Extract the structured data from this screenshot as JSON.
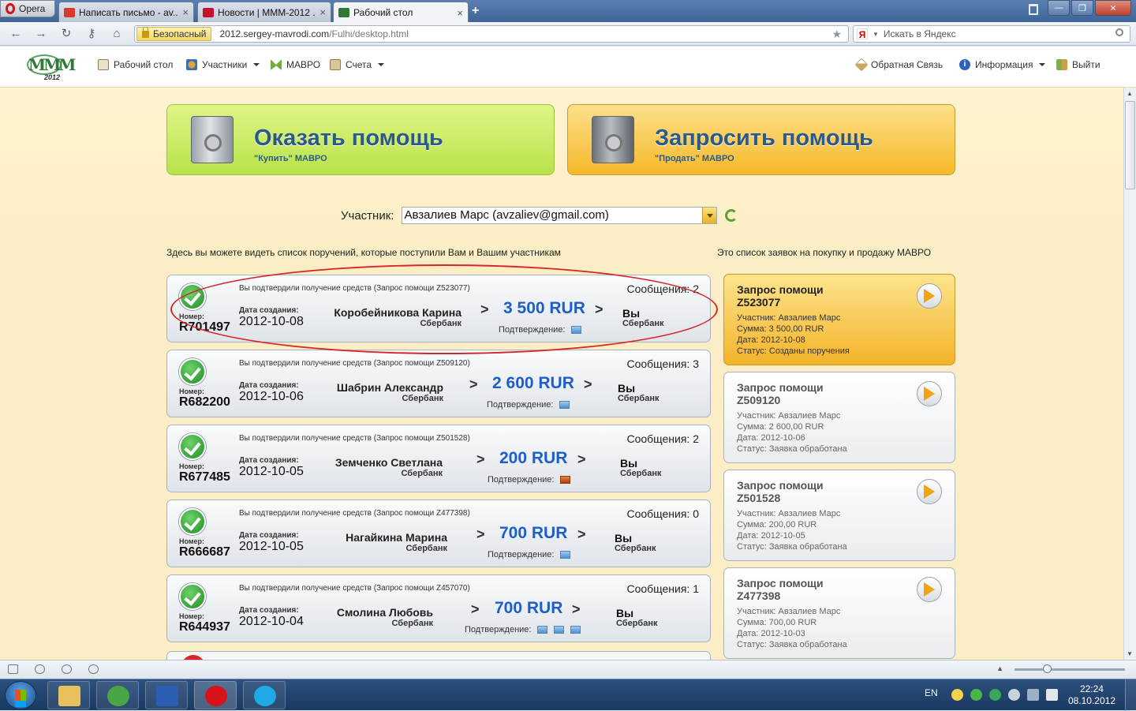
{
  "browser": {
    "menu_label": "Opera",
    "tabs": [
      {
        "title": "Написать письмо - av...",
        "close": "×",
        "favicon_color": "#d93a2b"
      },
      {
        "title": "Новости | МММ-2012 ...",
        "close": "×",
        "favicon_color": "#c8102e"
      },
      {
        "title": "Рабочий стол",
        "close": "×",
        "favicon_color": "#2f7a3b"
      }
    ],
    "new_tab": "+",
    "security_label": "Безопасный",
    "url_domain": "2012.sergey-mavrodi.com",
    "url_path": "/Fulhi/desktop.html",
    "search_placeholder": "Искать в Яндекс",
    "search_engine": "Я"
  },
  "site": {
    "logo_text": "МММ",
    "logo_year": "2012",
    "nav": [
      {
        "label": "Рабочий стол",
        "icon": "desktop-icon",
        "dropdown": false
      },
      {
        "label": "Участники",
        "icon": "users-icon",
        "dropdown": true
      },
      {
        "label": "МАВРО",
        "icon": "mavro-icon",
        "dropdown": false
      },
      {
        "label": "Счета",
        "icon": "accounts-icon",
        "dropdown": true
      }
    ],
    "nav_right": [
      {
        "label": "Обратная Связь",
        "icon": "feedback-icon",
        "dropdown": false
      },
      {
        "label": "Информация",
        "icon": "info-icon",
        "dropdown": true
      },
      {
        "label": "Выйти",
        "icon": "logout-icon",
        "dropdown": false
      }
    ]
  },
  "actions": {
    "give_title": "Оказать помощь",
    "give_sub": "\"Купить\" МАВРО",
    "ask_title": "Запросить помощь",
    "ask_sub": "\"Продать\" МАВРО"
  },
  "member": {
    "label": "Участник:",
    "value": "Авзалиев Марс (avzaliev@gmail.com)"
  },
  "captions": {
    "orders": "Здесь вы можете видеть список поручений, которые поступили Вам и Вашим участникам",
    "requests": "Это список заявок на покупку и продажу МАВРО"
  },
  "orders": [
    {
      "note": "Вы подтвердили получение средств (Запрос помощи Z523077)",
      "messages": "Сообщения: 2",
      "number_label": "Номер:",
      "number": "R701497",
      "date_label": "Дата создания:",
      "date": "2012-10-08",
      "name": "Коробейникова Карина",
      "bank": "Сбербанк",
      "gt": ">",
      "amount": "3 500 RUR",
      "confirm": "Подтверждение:",
      "you": "Вы",
      "you_bank": "Сбербанк",
      "images": [
        "blue"
      ]
    },
    {
      "note": "Вы подтвердили получение средств (Запрос помощи Z509120)",
      "messages": "Сообщения: 3",
      "number_label": "Номер:",
      "number": "R682200",
      "date_label": "Дата создания:",
      "date": "2012-10-06",
      "name": "Шабрин Александр",
      "bank": "Сбербанк",
      "gt": ">",
      "amount": "2 600 RUR",
      "confirm": "Подтверждение:",
      "you": "Вы",
      "you_bank": "Сбербанк",
      "images": [
        "blue"
      ]
    },
    {
      "note": "Вы подтвердили получение средств (Запрос помощи Z501528)",
      "messages": "Сообщения: 2",
      "number_label": "Номер:",
      "number": "R677485",
      "date_label": "Дата создания:",
      "date": "2012-10-05",
      "name": "Земченко Светлана",
      "bank": "Сбербанк",
      "gt": ">",
      "amount": "200 RUR",
      "confirm": "Подтверждение:",
      "you": "Вы",
      "you_bank": "Сбербанк",
      "images": [
        "red"
      ]
    },
    {
      "note": "Вы подтвердили получение средств (Запрос помощи Z477398)",
      "messages": "Сообщения: 0",
      "number_label": "Номер:",
      "number": "R666687",
      "date_label": "Дата создания:",
      "date": "2012-10-05",
      "name": "Нагайкина Марина",
      "bank": "Сбербанк",
      "gt": ">",
      "amount": "700 RUR",
      "confirm": "Подтверждение:",
      "you": "Вы",
      "you_bank": "Сбербанк",
      "images": [
        "blue"
      ]
    },
    {
      "note": "Вы подтвердили получение средств (Запрос помощи Z457070)",
      "messages": "Сообщения: 1",
      "number_label": "Номер:",
      "number": "R644937",
      "date_label": "Дата создания:",
      "date": "2012-10-04",
      "name": "Смолина Любовь",
      "bank": "Сбербанк",
      "gt": ">",
      "amount": "700 RUR",
      "confirm": "Подтверждение:",
      "you": "Вы",
      "you_bank": "Сбербанк",
      "images": [
        "blue",
        "blue",
        "blue"
      ]
    }
  ],
  "requests": [
    {
      "title": "Запрос помощи",
      "id": "Z523077",
      "member": "Участник: Авзалиев Марс",
      "sum": "Сумма: 3 500,00 RUR",
      "date": "Дата: 2012-10-08",
      "status": "Статус: Созданы поручения",
      "active": true
    },
    {
      "title": "Запрос помощи",
      "id": "Z509120",
      "member": "Участник: Авзалиев Марс",
      "sum": "Сумма: 2 600,00 RUR",
      "date": "Дата: 2012-10-06",
      "status": "Статус: Заявка обработана",
      "active": false
    },
    {
      "title": "Запрос помощи",
      "id": "Z501528",
      "member": "Участник: Авзалиев Марс",
      "sum": "Сумма: 200,00 RUR",
      "date": "Дата: 2012-10-05",
      "status": "Статус: Заявка обработана",
      "active": false
    },
    {
      "title": "Запрос помощи",
      "id": "Z477398",
      "member": "Участник: Авзалиев Марс",
      "sum": "Сумма: 700,00 RUR",
      "date": "Дата: 2012-10-03",
      "status": "Статус: Заявка обработана",
      "active": false
    }
  ],
  "taskbar": {
    "lang": "EN",
    "time": "22:24",
    "date": "08.10.2012",
    "apps": [
      {
        "name": "explorer",
        "color": "#e7c15b",
        "active": false
      },
      {
        "name": "chrome",
        "color": "#4aa546",
        "active": false
      },
      {
        "name": "save",
        "color": "#2c5fb3",
        "active": false
      },
      {
        "name": "opera",
        "color": "#d6131b",
        "active": true
      },
      {
        "name": "skype",
        "color": "#1fa9e6",
        "active": false
      }
    ]
  },
  "colors": {
    "amount_blue": "#1d5ec8",
    "give_green": "#c4ea5a",
    "ask_orange": "#f8c94a",
    "highlight_red": "#d6262b"
  }
}
